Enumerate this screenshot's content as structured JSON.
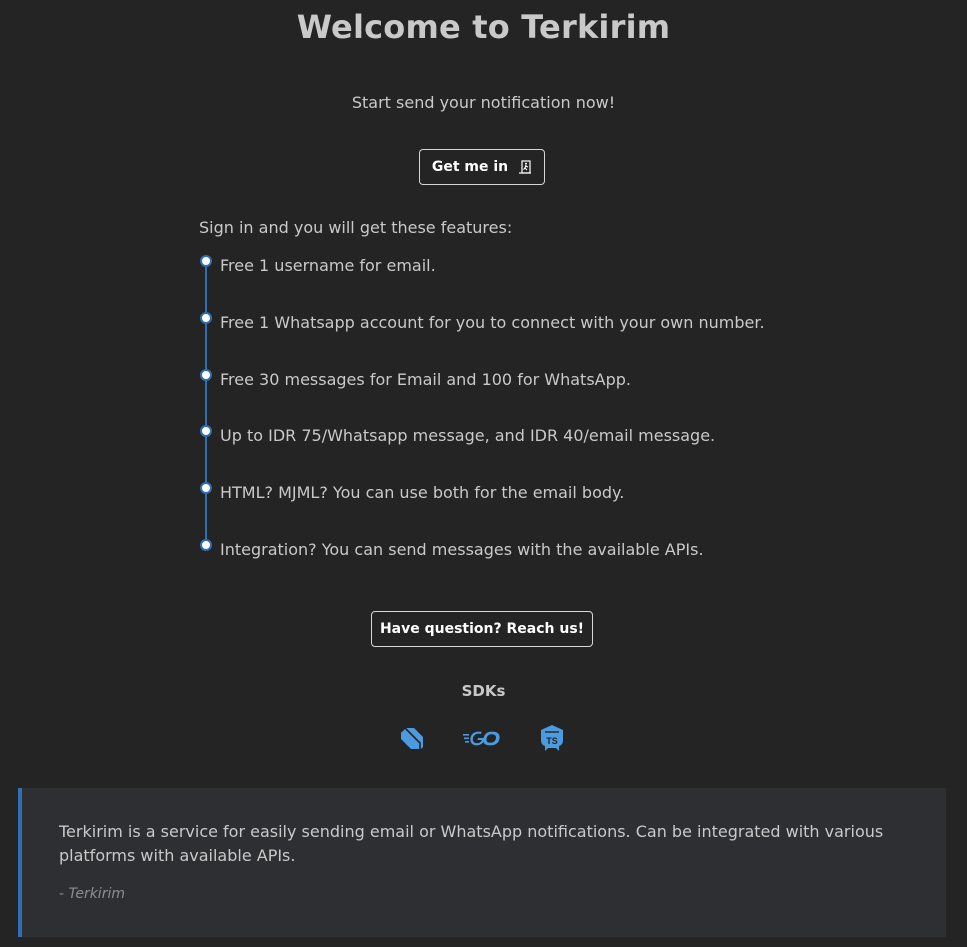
{
  "header": {
    "title": "Welcome to Terkirim",
    "subtitle": "Start send your notification now!"
  },
  "cta": {
    "get_in_label": "Get me in",
    "get_in_icon": "door-enter-icon"
  },
  "features": {
    "heading": "Sign in and you will get these features:",
    "items": [
      "Free 1 username for email.",
      "Free 1 Whatsapp account for you to connect with your own number.",
      "Free 30 messages for Email and 100 for WhatsApp.",
      "Up to IDR 75/Whatsapp message, and IDR 40/email message.",
      "HTML? MJML? You can use both for the email body.",
      "Integration? You can send messages with the available APIs."
    ]
  },
  "contact": {
    "label": "Have question? Reach us!"
  },
  "sdks": {
    "heading": "SDKs",
    "items": [
      {
        "name": "dart",
        "icon": "dart-logo-icon"
      },
      {
        "name": "go",
        "icon": "go-logo-icon"
      },
      {
        "name": "typescript",
        "icon": "typescript-logo-icon"
      }
    ]
  },
  "quote": {
    "text": "Terkirim is a service for easily sending email or WhatsApp notifications. Can be integrated with various platforms with available APIs.",
    "cite": "- Terkirim"
  },
  "colors": {
    "background": "#242424",
    "accent": "#2f6fb3",
    "sdk_icon": "#4a9be0",
    "quote_bg": "#2e2f33"
  }
}
